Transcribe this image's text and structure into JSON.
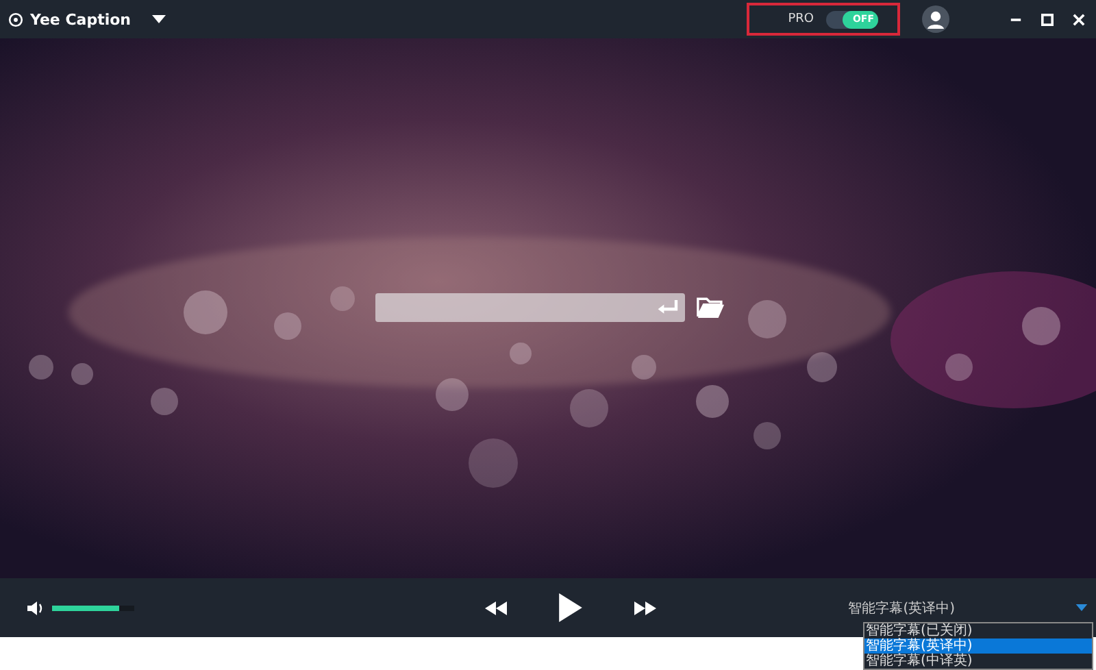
{
  "window": {
    "title": "Yee Caption"
  },
  "pro": {
    "label": "PRO",
    "toggle": {
      "on": false,
      "label": "OFF"
    }
  },
  "player": {
    "volume": {
      "level": 0.82
    }
  },
  "caption_mode": {
    "value": "智能字幕(英译中)",
    "expanded": true,
    "options": [
      {
        "label": "智能字幕(已关闭)",
        "selected": false
      },
      {
        "label": "智能字幕(英译中)",
        "selected": true
      },
      {
        "label": "智能字幕(中译英)",
        "selected": false
      }
    ]
  }
}
